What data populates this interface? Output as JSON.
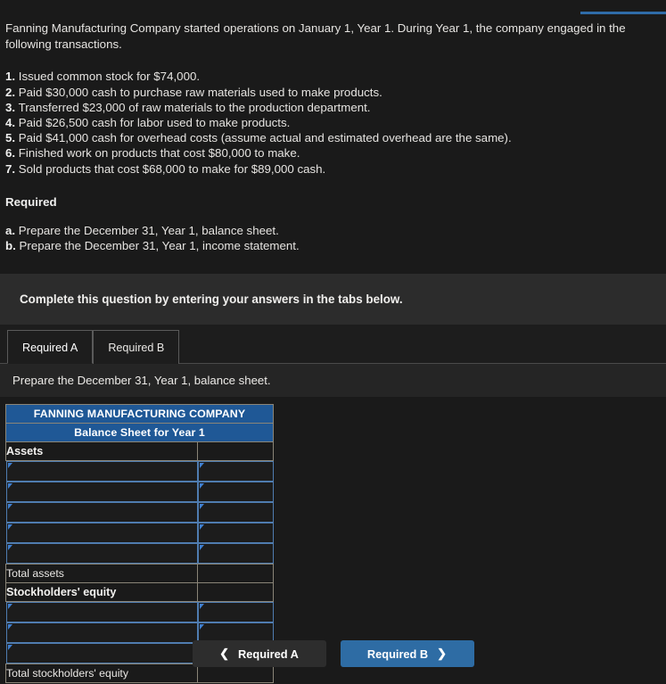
{
  "intro": {
    "paragraph": "Fanning Manufacturing Company started operations on January 1, Year 1. During Year 1, the company engaged in the following transactions."
  },
  "transactions": [
    {
      "num": "1.",
      "text": "Issued common stock for $74,000."
    },
    {
      "num": "2.",
      "text": "Paid $30,000 cash to purchase raw materials used to make products."
    },
    {
      "num": "3.",
      "text": "Transferred $23,000 of raw materials to the production department."
    },
    {
      "num": "4.",
      "text": "Paid $26,500 cash for labor used to make products."
    },
    {
      "num": "5.",
      "text": "Paid $41,000 cash for overhead costs (assume actual and estimated overhead are the same)."
    },
    {
      "num": "6.",
      "text": "Finished work on products that cost $80,000 to make."
    },
    {
      "num": "7.",
      "text": "Sold products that cost $68,000 to make for $89,000 cash."
    }
  ],
  "required": {
    "heading": "Required",
    "items": [
      {
        "letter": "a.",
        "text": "Prepare the December 31, Year 1, balance sheet."
      },
      {
        "letter": "b.",
        "text": "Prepare the December 31, Year 1, income statement."
      }
    ]
  },
  "instruction_banner": {
    "text": "Complete this question by entering your answers in the tabs below."
  },
  "tabs": [
    {
      "label": "Required A",
      "active": true
    },
    {
      "label": "Required B",
      "active": false
    }
  ],
  "subprompt": {
    "text": "Prepare the December 31, Year 1, balance sheet."
  },
  "balance_sheet": {
    "company_title": "FANNING MANUFACTURING COMPANY",
    "statement_title": "Balance Sheet for Year 1",
    "assets_section_label": "Assets",
    "assets_input_rows": 5,
    "total_assets_label": "Total assets",
    "total_assets_value": "",
    "equity_section_label": "Stockholders' equity",
    "equity_input_rows": 3,
    "total_equity_label": "Total stockholders' equity",
    "total_equity_value": "",
    "input_placeholder": ""
  },
  "navigation": {
    "prev_label": "Required A",
    "prev_icon": "chevron-left-icon",
    "next_label": "Required B",
    "next_icon": "chevron-right-icon"
  },
  "colors": {
    "page_bg": "#1a1a1a",
    "banner_bg": "#2c2c2c",
    "subprompt_bg": "#252525",
    "table_header_blue": "#1f5896",
    "input_border_blue": "#4f7cb0",
    "primary_button": "#2e6ca4",
    "secondary_button": "#2d2d2d"
  }
}
